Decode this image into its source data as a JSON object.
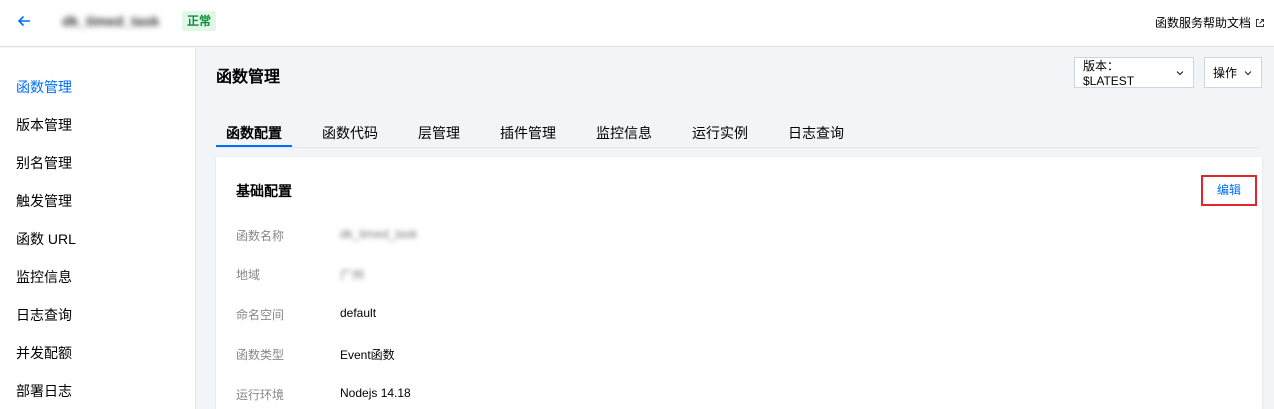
{
  "header": {
    "function_name": "dk_timed_task",
    "status": "正常",
    "help_link": "函数服务帮助文档"
  },
  "sidebar": {
    "items": [
      {
        "label": "函数管理",
        "active": true
      },
      {
        "label": "版本管理"
      },
      {
        "label": "别名管理"
      },
      {
        "label": "触发管理"
      },
      {
        "label": "函数 URL"
      },
      {
        "label": "监控信息"
      },
      {
        "label": "日志查询"
      },
      {
        "label": "并发配额"
      },
      {
        "label": "部署日志"
      }
    ]
  },
  "main": {
    "title": "函数管理",
    "version_dropdown": "版本：$LATEST",
    "actions_dropdown": "操作",
    "tabs": [
      {
        "label": "函数配置",
        "active": true
      },
      {
        "label": "函数代码"
      },
      {
        "label": "层管理"
      },
      {
        "label": "插件管理"
      },
      {
        "label": "监控信息"
      },
      {
        "label": "运行实例"
      },
      {
        "label": "日志查询"
      }
    ],
    "card": {
      "title": "基础配置",
      "edit_label": "编辑",
      "rows": [
        {
          "label": "函数名称",
          "value": "dk_timed_task"
        },
        {
          "label": "地域",
          "value": "广州"
        },
        {
          "label": "命名空间",
          "value": "default"
        },
        {
          "label": "函数类型",
          "value": "Event函数"
        },
        {
          "label": "运行环境",
          "value": "Nodejs 14.18"
        }
      ]
    }
  },
  "colors": {
    "accent": "#006eff",
    "status_green": "#0a8f38",
    "highlight_red": "#e0252d"
  }
}
